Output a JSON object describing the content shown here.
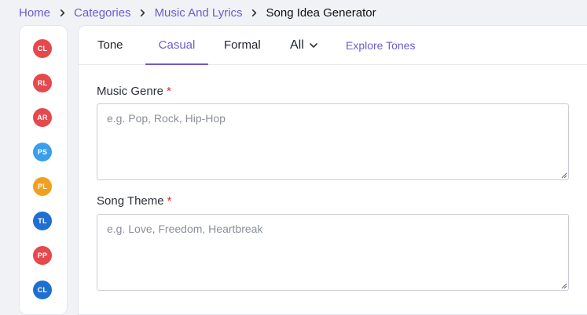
{
  "breadcrumb": {
    "items": [
      "Home",
      "Categories",
      "Music And Lyrics"
    ],
    "current": "Song Idea Generator"
  },
  "sidebar": {
    "avatars": [
      {
        "initials": "CL",
        "color": "#e5484d"
      },
      {
        "initials": "RL",
        "color": "#e5484d"
      },
      {
        "initials": "AR",
        "color": "#e5484d"
      },
      {
        "initials": "PS",
        "color": "#3b9eea"
      },
      {
        "initials": "PL",
        "color": "#f0a020"
      },
      {
        "initials": "TL",
        "color": "#1f6fd1"
      },
      {
        "initials": "PP",
        "color": "#e5484d"
      },
      {
        "initials": "CL",
        "color": "#1f6fd1"
      }
    ]
  },
  "tabs": {
    "label": "Tone",
    "items": [
      "Casual",
      "Formal"
    ],
    "active": "Casual",
    "dropdown": "All",
    "explore": "Explore Tones"
  },
  "form": {
    "genre": {
      "label": "Music Genre",
      "required": "*",
      "placeholder": "e.g. Pop, Rock, Hip-Hop",
      "value": ""
    },
    "theme": {
      "label": "Song Theme",
      "required": "*",
      "placeholder": "e.g. Love, Freedom, Heartbreak",
      "value": ""
    }
  },
  "colors": {
    "accent": "#6d5bd0",
    "required": "#e02424"
  }
}
